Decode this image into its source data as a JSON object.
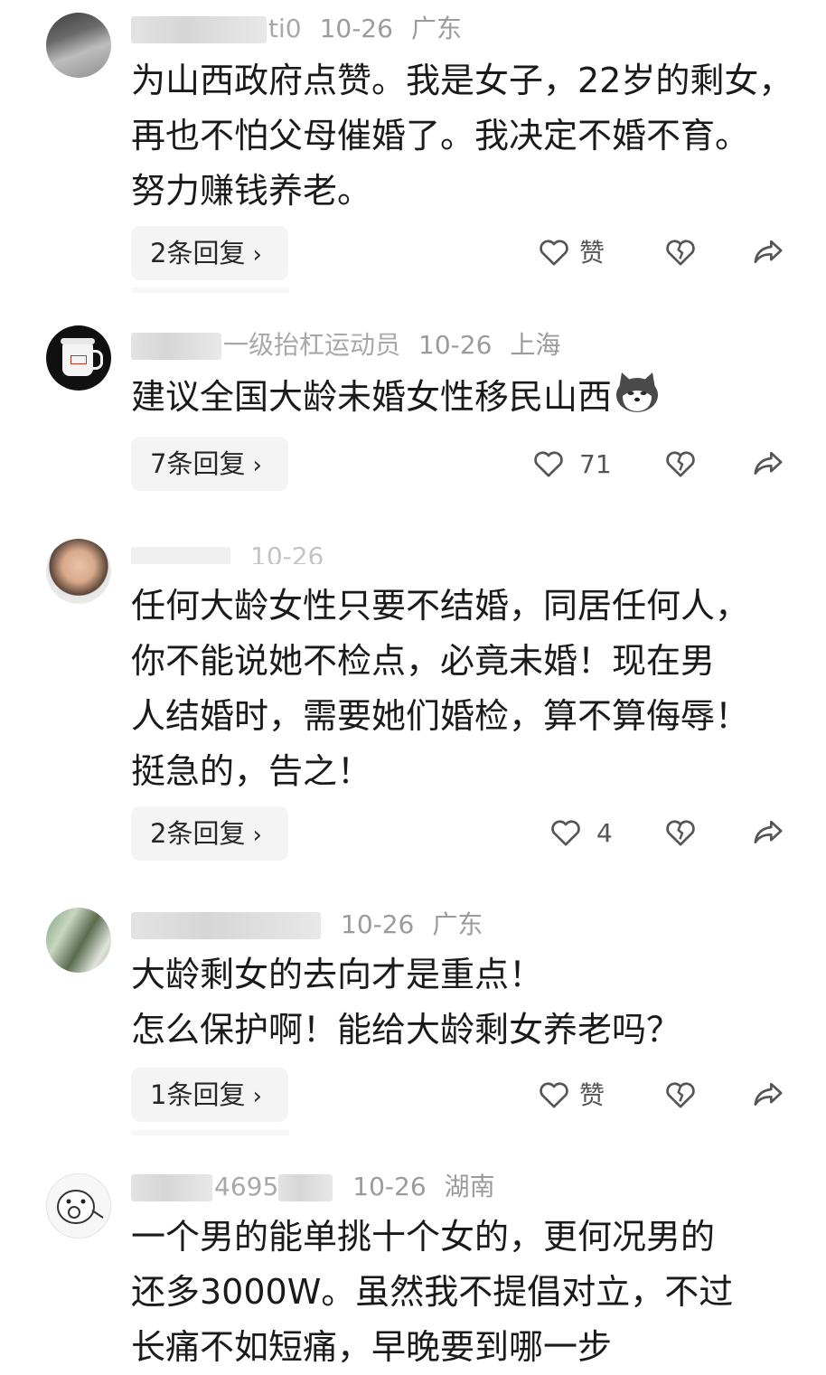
{
  "comments": [
    {
      "name": "ti0",
      "date": "10-26",
      "location": "广东",
      "text_lines": [
        "为山西政府点赞。我是女子，22岁的剩女，",
        "再也不怕父母催婚了。我决定不婚不育。",
        "努力赚钱养老。"
      ],
      "reply_label": "2条回复",
      "like_label": "赞"
    },
    {
      "name": "一级抬杠运动员",
      "date": "10-26",
      "location": "上海",
      "text_lines": [
        "建议全国大龄未婚女性移民山西"
      ],
      "reply_label": "7条回复",
      "like_label": "71"
    },
    {
      "name": "",
      "date": "10-26",
      "location": "",
      "text_lines": [
        "任何大龄女性只要不结婚，同居任何人，",
        "你不能说她不检点，必竟未婚！现在男",
        "人结婚时，需要她们婚检，算不算侮辱！",
        "挺急的，告之！"
      ],
      "reply_label": "2条回复",
      "like_label": "4"
    },
    {
      "name": "",
      "date": "10-26",
      "location": "广东",
      "text_lines": [
        "大龄剩女的去向才是重点！",
        "怎么保护啊！能给大龄剩女养老吗？"
      ],
      "reply_label": "1条回复",
      "like_label": "赞"
    },
    {
      "name": "4695",
      "date": "10-26",
      "location": "湖南",
      "text_lines": [
        "一个男的能单挑十个女的，更何况男的",
        "还多3000W。虽然我不提倡对立，不过",
        "长痛不如短痛，早晚要到哪一步"
      ]
    }
  ],
  "icons": {
    "like": "heart-outline-icon",
    "dislike": "broken-heart-icon",
    "share": "share-arrow-icon",
    "chevron": "chevron-right-icon",
    "emoji": "shiba-dog-emoji"
  },
  "colors": {
    "text": "#1a1a1a",
    "meta": "#9b9b9b",
    "reply_bg": "#f4f4f4",
    "icon": "#555555"
  }
}
